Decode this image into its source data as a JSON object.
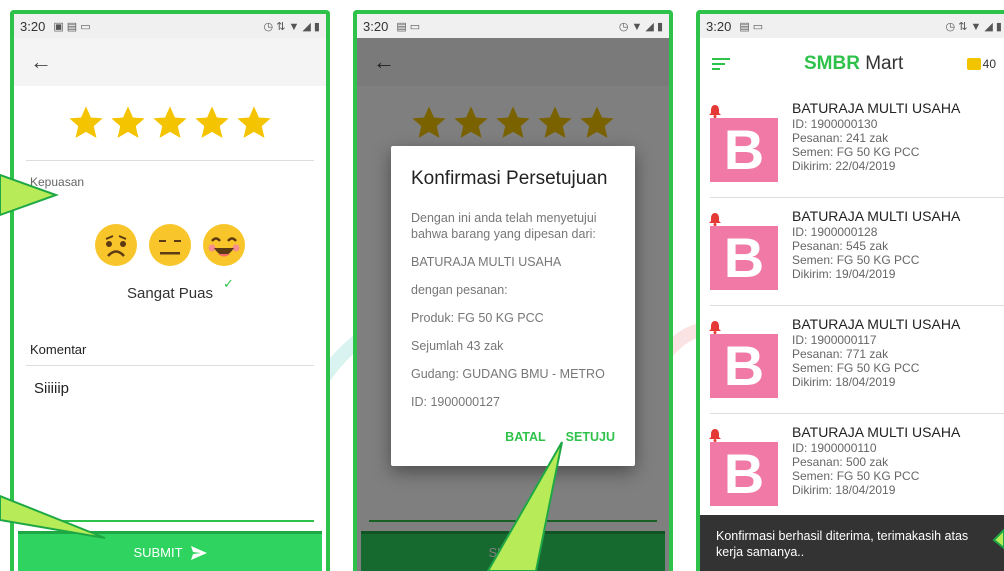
{
  "status": {
    "time": "3:20"
  },
  "screen1": {
    "section_label": "Kepuasan",
    "satisfaction_text": "Sangat Puas",
    "comment_label": "Komentar",
    "comment_value": "Siiiiip",
    "submit_label": "SUBMIT",
    "star_count": 5,
    "selected_face": "happy"
  },
  "screen2": {
    "submit_label": "SUBMIT",
    "dialog": {
      "title": "Konfirmasi Persetujuan",
      "intro": "Dengan ini anda telah menyetujui bahwa barang yang dipesan dari:",
      "buyer": "BATURAJA MULTI USAHA",
      "order_label": "dengan pesanan:",
      "product": "Produk: FG 50 KG PCC",
      "quantity": "Sejumlah 43 zak",
      "warehouse": "Gudang: GUDANG BMU - METRO",
      "order_id": "ID: 1900000127",
      "cancel_label": "BATAL",
      "confirm_label": "SETUJU"
    }
  },
  "screen3": {
    "brand_bold": "SMBR",
    "brand_rest": " Mart",
    "wallet_text": "40",
    "orders": [
      {
        "name": "BATURAJA MULTI USAHA",
        "id": "ID: 1900000130",
        "qty": "Pesanan: 241 zak",
        "product": "Semen: FG 50 KG PCC",
        "sent": "Dikirim: 22/04/2019",
        "avatar_letter": "B"
      },
      {
        "name": "BATURAJA MULTI USAHA",
        "id": "ID: 1900000128",
        "qty": "Pesanan: 545 zak",
        "product": "Semen: FG 50 KG PCC",
        "sent": "Dikirim: 19/04/2019",
        "avatar_letter": "B"
      },
      {
        "name": "BATURAJA MULTI USAHA",
        "id": "ID: 1900000117",
        "qty": "Pesanan: 771 zak",
        "product": "Semen: FG 50 KG PCC",
        "sent": "Dikirim: 18/04/2019",
        "avatar_letter": "B"
      },
      {
        "name": "BATURAJA MULTI USAHA",
        "id": "ID: 1900000110",
        "qty": "Pesanan: 500 zak",
        "product": "Semen: FG 50 KG PCC",
        "sent": "Dikirim: 18/04/2019",
        "avatar_letter": "B"
      }
    ],
    "snackbar_text": "Konfirmasi berhasil diterima, terimakasih atas kerja samanya.."
  },
  "colors": {
    "accent": "#2ec24a",
    "submit_bg": "#2ed45f",
    "star": "#f5c400",
    "avatar": "#f07aa5",
    "bell": "#e53935",
    "snackbar": "#333333"
  },
  "icons": [
    "back-arrow-icon",
    "star-icon",
    "sad-face-icon",
    "neutral-face-icon",
    "happy-face-icon",
    "check-icon",
    "send-icon",
    "menu-icon",
    "wallet-icon",
    "bell-icon"
  ]
}
